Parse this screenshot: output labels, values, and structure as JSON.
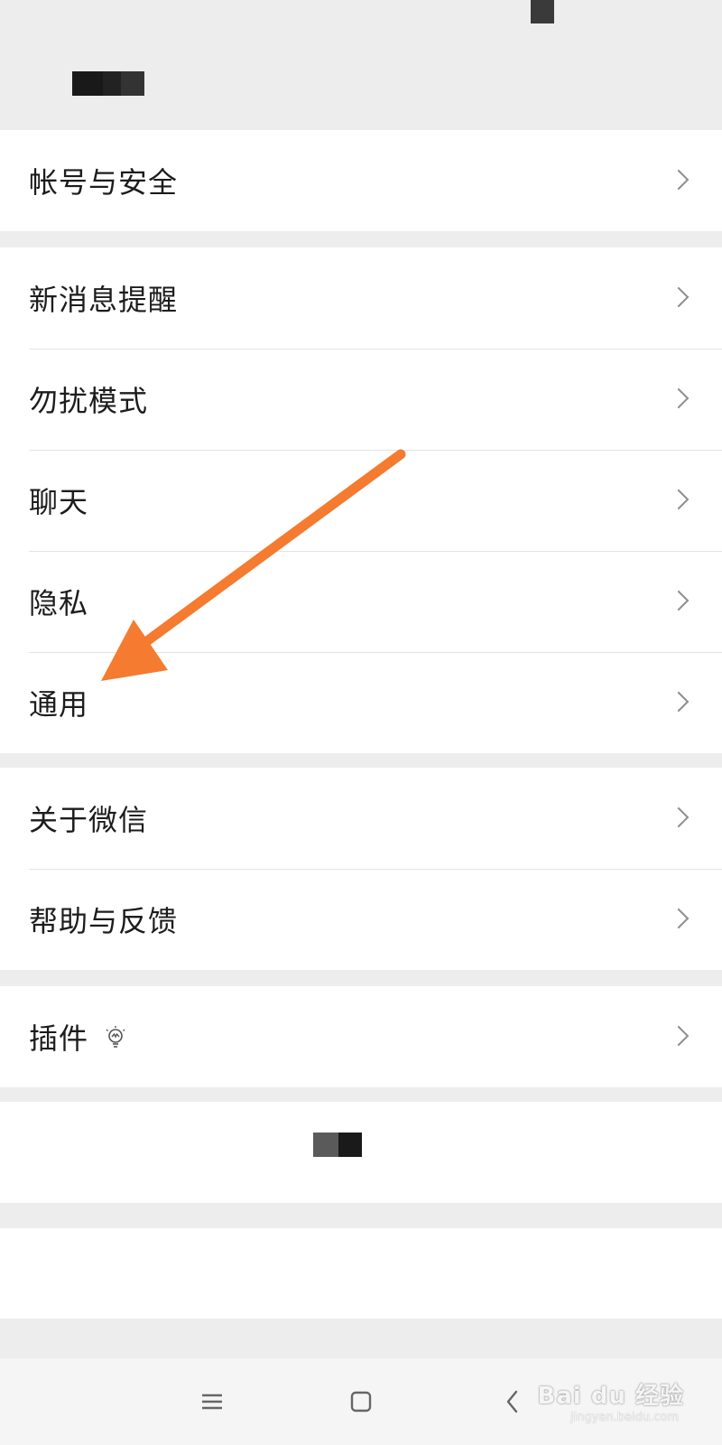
{
  "settings": {
    "group1": [
      {
        "label": "帐号与安全"
      }
    ],
    "group2": [
      {
        "label": "新消息提醒"
      },
      {
        "label": "勿扰模式"
      },
      {
        "label": "聊天"
      },
      {
        "label": "隐私"
      },
      {
        "label": "通用"
      }
    ],
    "group3": [
      {
        "label": "关于微信"
      },
      {
        "label": "帮助与反馈"
      }
    ],
    "group4": [
      {
        "label": "插件",
        "icon": "lightbulb-icon"
      }
    ]
  },
  "annotation": {
    "arrow_color": "#f47b30",
    "points_to": "通用"
  },
  "colors": {
    "background": "#ededed",
    "row": "#ffffff",
    "divider": "#e3e3e3",
    "chevron": "#8f8f8f",
    "arrow": "#f47b30"
  },
  "navbar": {
    "icons": [
      "menu-icon",
      "home-icon",
      "back-icon"
    ]
  },
  "watermark": {
    "brand": "Bai du 经验",
    "url": "jingyan.baidu.com"
  }
}
